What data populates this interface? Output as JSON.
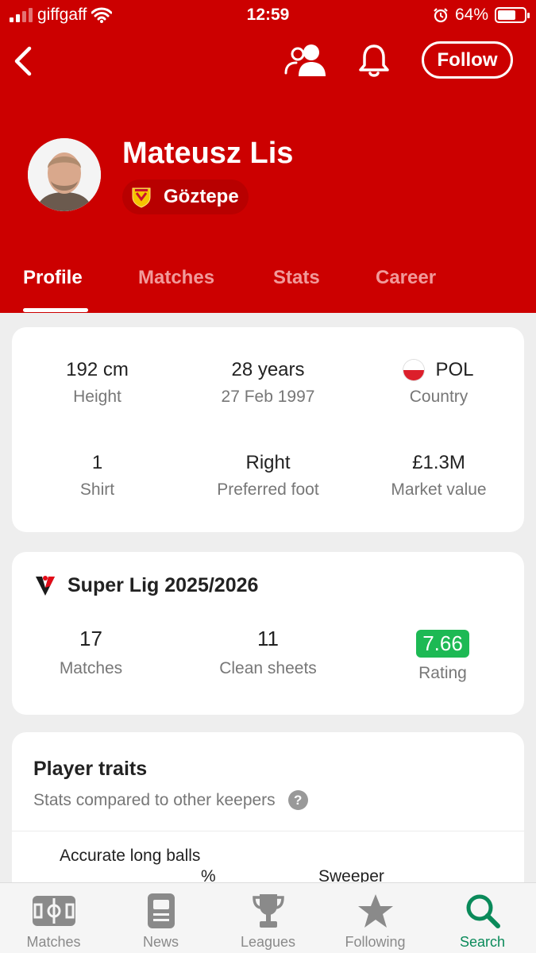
{
  "status_bar": {
    "carrier": "giffgaff",
    "time": "12:59",
    "battery": "64%"
  },
  "header": {
    "follow_label": "Follow",
    "player_name": "Mateusz Lis",
    "team_name": "Göztepe",
    "accent_color": "#cc0000"
  },
  "tabs": [
    {
      "label": "Profile",
      "active": true
    },
    {
      "label": "Matches"
    },
    {
      "label": "Stats"
    },
    {
      "label": "Career"
    }
  ],
  "info": {
    "height": {
      "value": "192 cm",
      "label": "Height"
    },
    "age": {
      "value": "28 years",
      "label": "27 Feb 1997"
    },
    "country": {
      "value": "POL",
      "label": "Country"
    },
    "shirt": {
      "value": "1",
      "label": "Shirt"
    },
    "foot": {
      "value": "Right",
      "label": "Preferred foot"
    },
    "market": {
      "value": "£1.3M",
      "label": "Market value"
    }
  },
  "league": {
    "title": "Super Lig 2025/2026",
    "matches": {
      "value": "17",
      "label": "Matches"
    },
    "clean_sheets": {
      "value": "11",
      "label": "Clean sheets"
    },
    "rating": {
      "value": "7.66",
      "label": "Rating",
      "color": "#1db954"
    }
  },
  "traits": {
    "title": "Player traits",
    "subtitle": "Stats compared to other keepers",
    "help": "?",
    "label_1_line1": "Accurate long balls",
    "label_1_line2": "%",
    "label_2": "Sweeper"
  },
  "bottom_nav": [
    {
      "label": "Matches",
      "icon": "pitch-icon"
    },
    {
      "label": "News",
      "icon": "news-icon"
    },
    {
      "label": "Leagues",
      "icon": "trophy-icon"
    },
    {
      "label": "Following",
      "icon": "star-icon"
    },
    {
      "label": "Search",
      "icon": "search-icon",
      "active": true
    }
  ]
}
